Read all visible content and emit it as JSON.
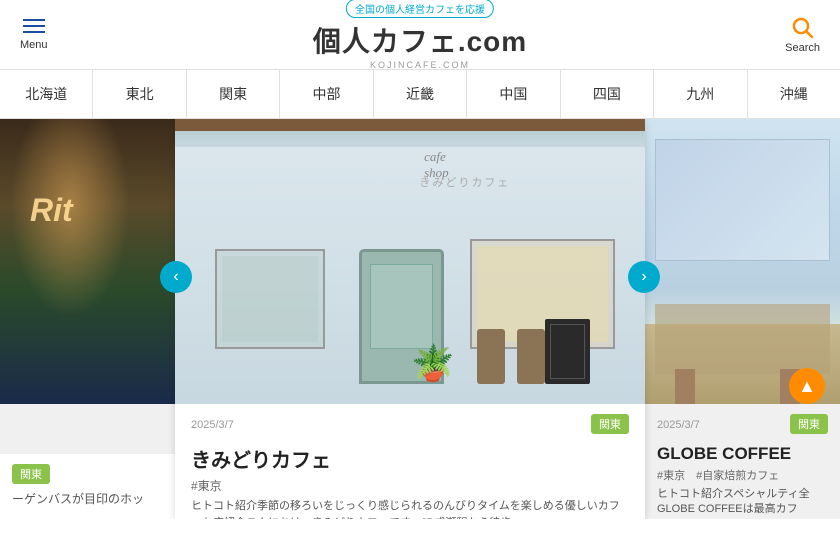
{
  "header": {
    "menu_label": "Menu",
    "tagline": "全国の個人経営カフェを応援",
    "title": "個人カフェ.com",
    "subtitle": "KOJINCAFE.COM",
    "search_label": "Search"
  },
  "nav": {
    "items": [
      {
        "label": "北海道"
      },
      {
        "label": "東北"
      },
      {
        "label": "関東"
      },
      {
        "label": "中部"
      },
      {
        "label": "近畿"
      },
      {
        "label": "中国"
      },
      {
        "label": "四国"
      },
      {
        "label": "九州"
      },
      {
        "label": "沖縄"
      }
    ]
  },
  "cards": {
    "left": {
      "tag": "関東",
      "date": "",
      "title": "",
      "meta": "",
      "desc": "ーゲンバスが目印のホッ"
    },
    "center": {
      "tag": "関東",
      "date": "2025/3/7",
      "title": "きみどりカフェ",
      "meta": "#東京",
      "desc": "ヒトコト紹介季節の移ろいをじっくり感じられるのんびりタイムを楽しめる優しいカフェお店紹介こんにちは、きみどりカフェです。JR成瀬駅から徒歩"
    },
    "right": {
      "tag": "関東",
      "date": "2025/3/7",
      "title": "GLOBE COFFEE",
      "meta": "#東京　#自家焙煎カフェ",
      "desc": "ヒトコト紹介スペシャルティ全GLOBE COFFEEは最高カフ"
    }
  },
  "arrows": {
    "left": "‹",
    "right": "›"
  },
  "scroll_top": "▲"
}
